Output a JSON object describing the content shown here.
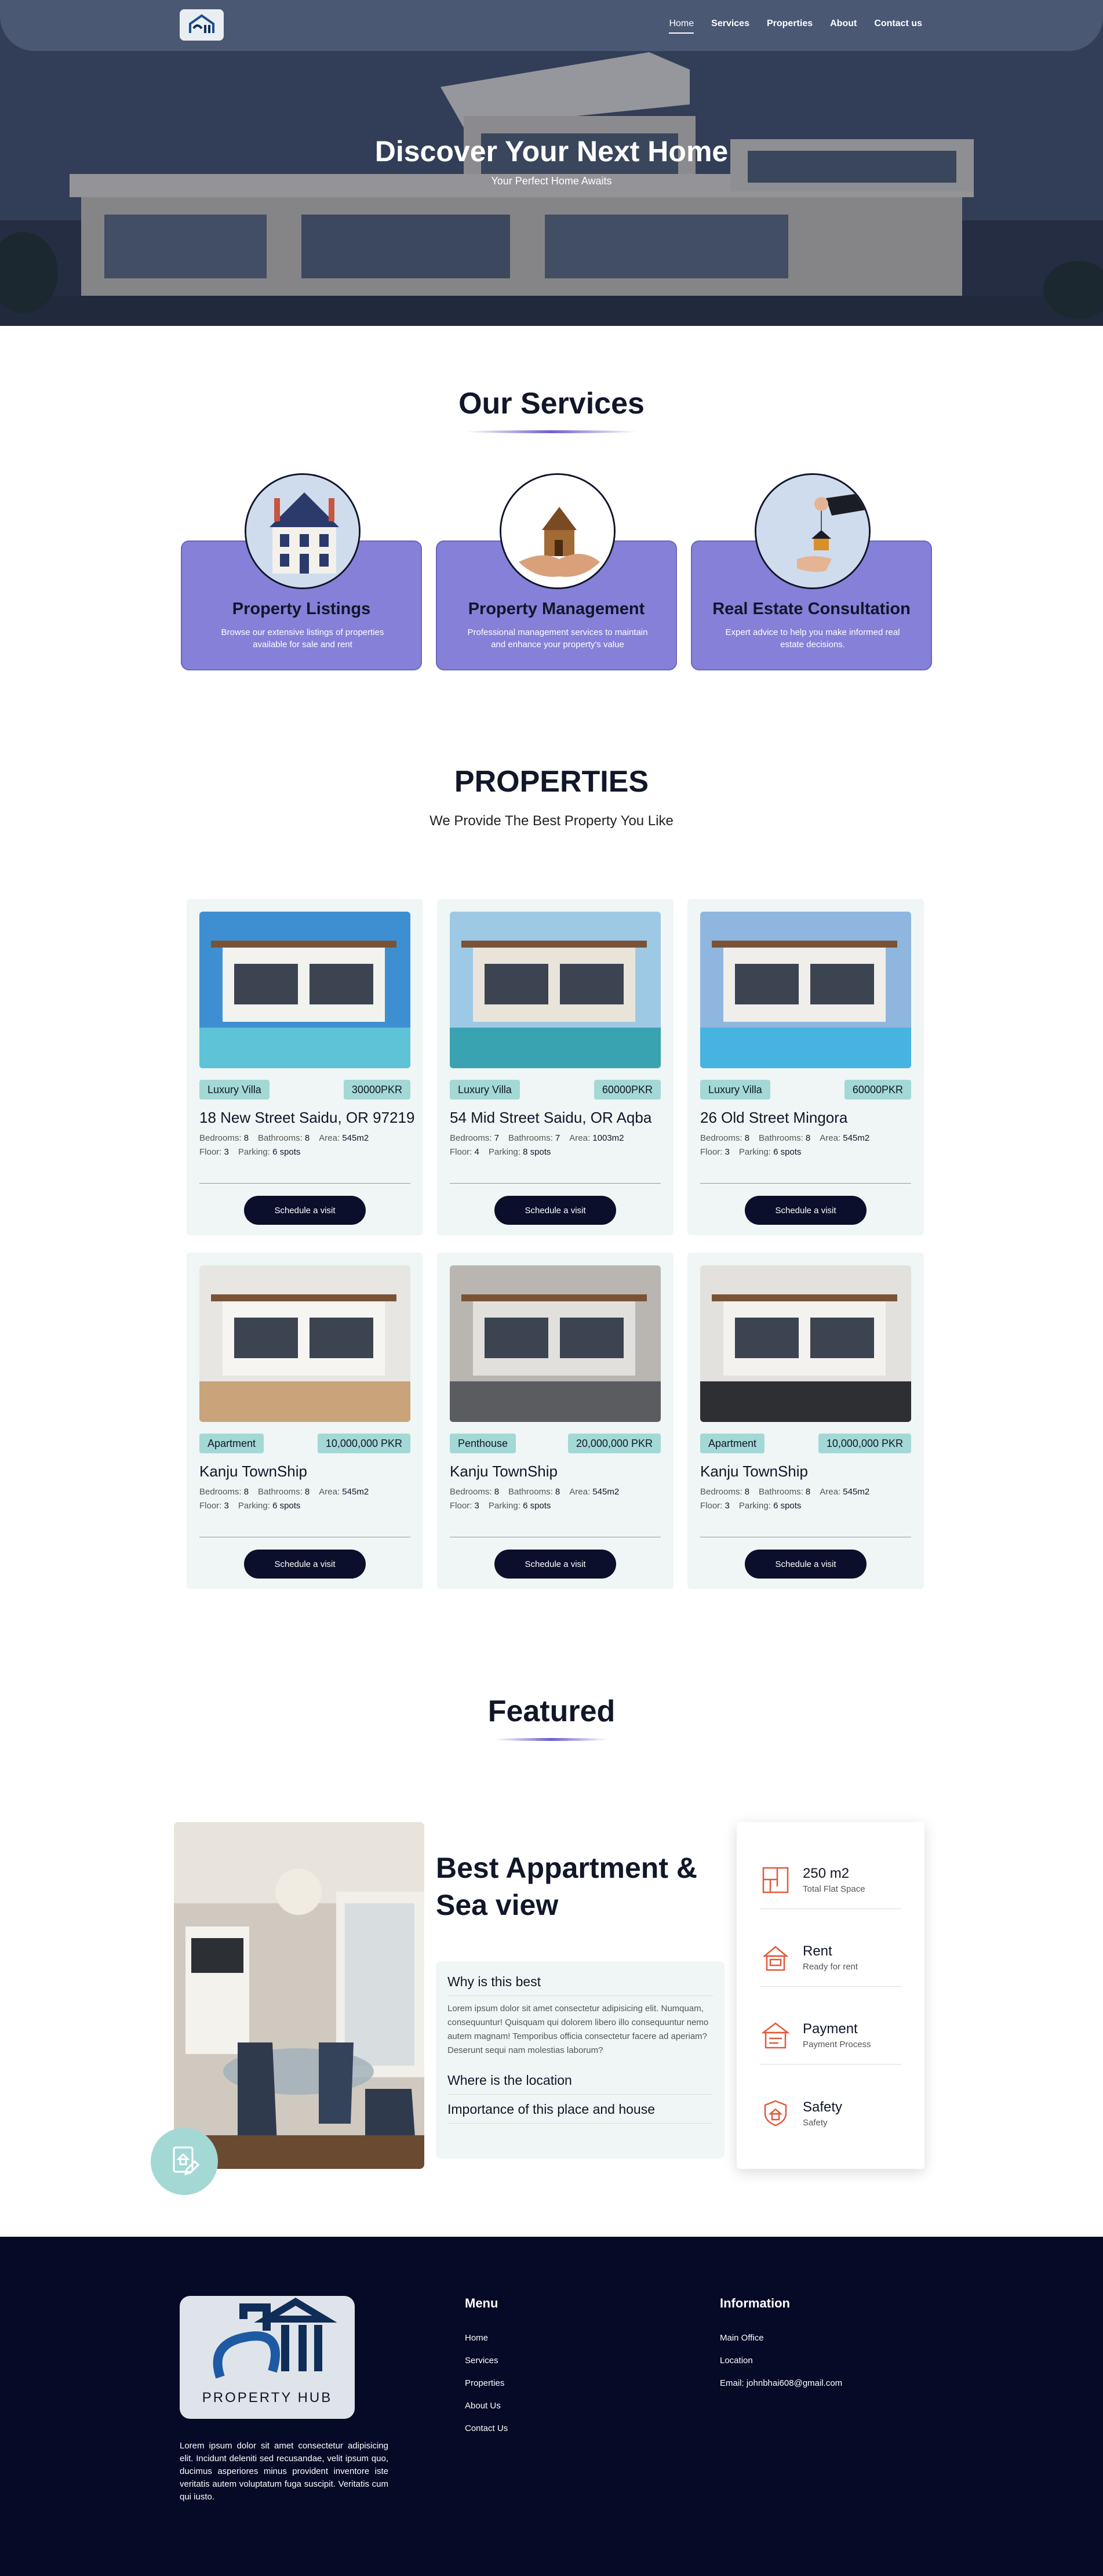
{
  "nav": {
    "links": [
      "Home",
      "Services",
      "Properties",
      "About",
      "Contact us"
    ],
    "active": "Home"
  },
  "hero": {
    "title": "Discover Your Next Home",
    "subtitle": "Your Perfect Home Awaits"
  },
  "services": {
    "title": "Our Services",
    "items": [
      {
        "title": "Property Listings",
        "desc": "Browse our extensive listings of properties available for sale and rent"
      },
      {
        "title": "Property Management",
        "desc": "Professional management services to maintain and enhance your property's value"
      },
      {
        "title": "Real Estate Consultation",
        "desc": "Expert advice to help you make informed real estate decisions."
      }
    ]
  },
  "properties": {
    "title": "PROPERTIES",
    "subtitle": "We Provide The Best Property You Like",
    "button_label": "Schedule a visit",
    "labels": {
      "bedrooms": "Bedrooms:",
      "bathrooms": "Bathrooms:",
      "area": "Area:",
      "floor": "Floor:",
      "parking": "Parking:"
    },
    "items": [
      {
        "type": "Luxury Villa",
        "price": "30000PKR",
        "address": "18 New Street Saidu, OR 97219",
        "bedrooms": "8",
        "bathrooms": "8",
        "area": "545m2",
        "floor": "3",
        "parking": "6 spots"
      },
      {
        "type": "Luxury Villa",
        "price": "60000PKR",
        "address": "54 Mid Street Saidu, OR Aqba",
        "bedrooms": "7",
        "bathrooms": "7",
        "area": "1003m2",
        "floor": "4",
        "parking": "8 spots"
      },
      {
        "type": "Luxury Villa",
        "price": "60000PKR",
        "address": "26 Old Street Mingora",
        "bedrooms": "8",
        "bathrooms": "8",
        "area": "545m2",
        "floor": "3",
        "parking": "6 spots"
      },
      {
        "type": "Apartment",
        "price": "10,000,000 PKR",
        "address": "Kanju TownShip",
        "bedrooms": "8",
        "bathrooms": "8",
        "area": "545m2",
        "floor": "3",
        "parking": "6 spots"
      },
      {
        "type": "Penthouse",
        "price": "20,000,000 PKR",
        "address": "Kanju TownShip",
        "bedrooms": "8",
        "bathrooms": "8",
        "area": "545m2",
        "floor": "3",
        "parking": "6 spots"
      },
      {
        "type": "Apartment",
        "price": "10,000,000 PKR",
        "address": "Kanju TownShip",
        "bedrooms": "8",
        "bathrooms": "8",
        "area": "545m2",
        "floor": "3",
        "parking": "6 spots"
      }
    ]
  },
  "featured": {
    "title": "Featured",
    "heading": "Best Appartment & Sea view",
    "faq": [
      {
        "q": "Why is this best",
        "a": "Lorem ipsum dolor sit amet consectetur adipisicing elit. Numquam, consequuntur! Quisquam qui dolorem libero illo consequuntur nemo autem magnam! Temporibus officia consectetur facere ad aperiam? Deserunt sequi nam molestias laborum?"
      },
      {
        "q": "Where is the location"
      },
      {
        "q": "Importance of this place and house"
      }
    ],
    "stats": [
      {
        "value": "250 m2",
        "label": "Total Flat Space",
        "icon": "floorplan-icon"
      },
      {
        "value": "Rent",
        "label": "Ready for rent",
        "icon": "rent-icon"
      },
      {
        "value": "Payment",
        "label": "Payment Process",
        "icon": "payment-icon"
      },
      {
        "value": "Safety",
        "label": "Safety",
        "icon": "safety-icon"
      }
    ]
  },
  "footer": {
    "logo_text": "PROPERTY HUB",
    "about": "Lorem ipsum dolor sit amet consectetur adipisicing elit. Incidunt deleniti sed recusandae, velit ipsum quo, ducimus asperiores minus provident inventore iste veritatis autem voluptatum fuga suscipit. Veritatis cum qui iusto.",
    "menu_title": "Menu",
    "menu": [
      "Home",
      "Services",
      "Properties",
      "About Us",
      "Contact Us"
    ],
    "info_title": "Information",
    "info": [
      "Main Office",
      "Location",
      "Email: johnbhai608@gmail.com"
    ]
  },
  "colors": {
    "navy": "#050a26",
    "service_purple": "#8580d8",
    "mint": "#a3d8d5",
    "card_bg": "#eff6f5",
    "icon_orange": "#e2593b"
  }
}
